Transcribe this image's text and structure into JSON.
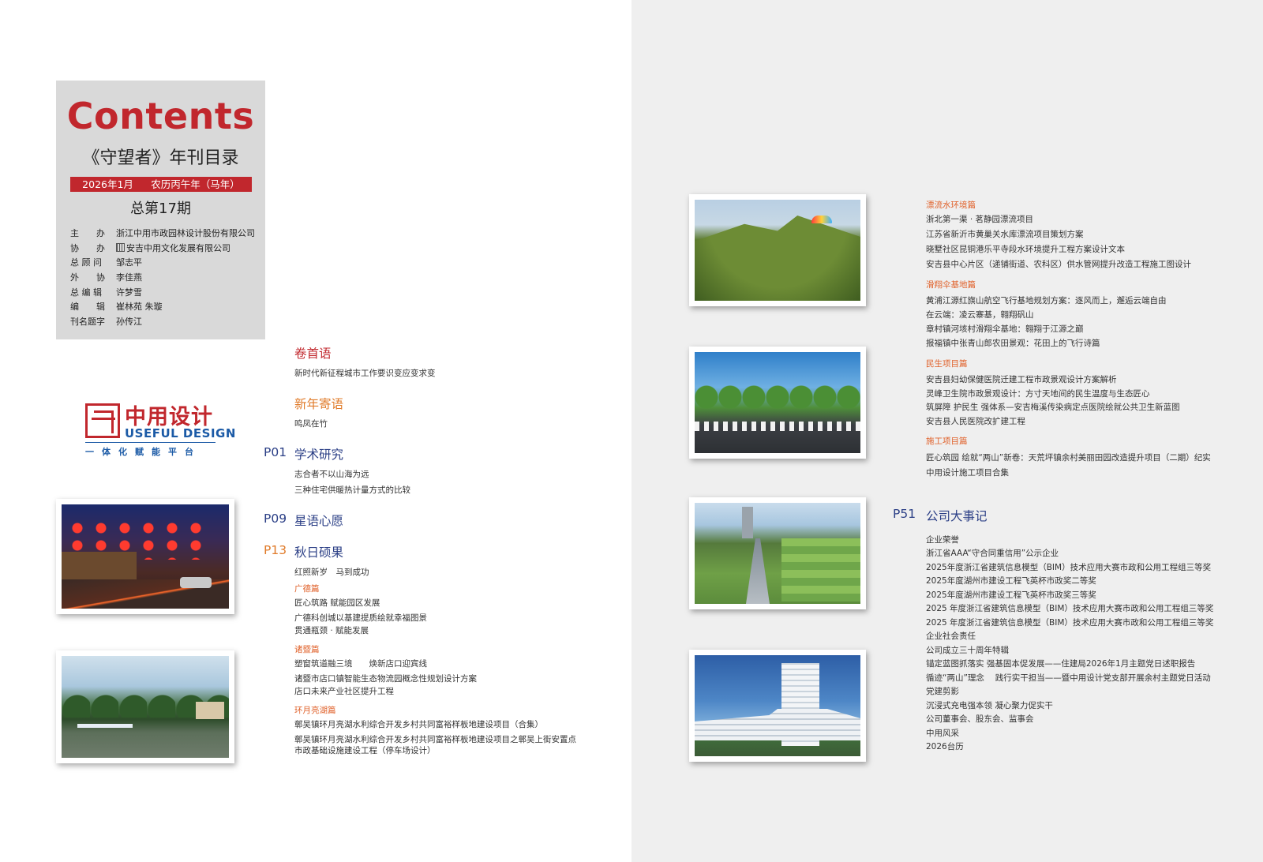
{
  "masthead": {
    "title": "Contents",
    "subtitle": "《守望者》年刊目录",
    "date": "2026年1月",
    "lunar": "农历丙午年（马年）",
    "issue": "总第17期",
    "credits": [
      {
        "role": "主　　办",
        "name": "浙江中用市政园林设计股份有限公司"
      },
      {
        "role": "协　　办",
        "name": "安吉中用文化发展有限公司"
      },
      {
        "role": "总 顾 问",
        "name": "邹志平"
      },
      {
        "role": "外　　协",
        "name": "李佳燕"
      },
      {
        "role": "总 编 辑",
        "name": "许梦雪"
      },
      {
        "role": "编　　辑",
        "name": "崔林苑 朱璇"
      },
      {
        "role": "刊名题字",
        "name": "孙传江"
      }
    ]
  },
  "logo": {
    "cn": "中用设计",
    "en": "USEFUL DESIGN",
    "tagline": "一体化赋能平台"
  },
  "left_toc": {
    "preface": {
      "title": "卷首语",
      "items": [
        "新时代新征程城市工作要识变应变求变"
      ]
    },
    "newyear": {
      "title": "新年寄语",
      "items": [
        "鸣凤在竹"
      ]
    },
    "academic": {
      "page": "P01",
      "title": "学术研究",
      "items": [
        "志合者不以山海为远",
        "三种住宅供暖热计量方式的比较"
      ]
    },
    "wishes": {
      "page": "P09",
      "title": "星语心愿"
    },
    "harvest": {
      "page": "P13",
      "title": "秋日硕果",
      "intro": "红照新岁　马到成功",
      "guangde": {
        "title": "广德篇",
        "items": [
          "匠心筑路 赋能园区发展",
          "广德科创城以基建提质绘就幸福图景",
          "贯通瓶颈 · 赋能发展"
        ]
      },
      "zhuji": {
        "title": "诸暨篇",
        "items": [
          "塑窗筑道融三境　　焕新店口迎宾线",
          "诸暨市店口镇智能生态物流园概念性规划设计方案",
          "店口未来产业社区提升工程"
        ]
      },
      "huanyue": {
        "title": "环月亮湖篇",
        "items": [
          "鄣吴镇环月亮湖水利综合开发乡村共同富裕样板地建设项目（合集）",
          "鄣吴镇环月亮湖水利综合开发乡村共同富裕样板地建设项目之鄣吴上街安置点",
          "市政基础设施建设工程（停车场设计）"
        ]
      }
    }
  },
  "right_toc": {
    "rafting": {
      "title": "漂流水环境篇",
      "items": [
        "浙北第一渠 · 茗静园漂流项目",
        "江苏省新沂市黄巢关水库漂流项目策划方案",
        "晓墅社区昆铜港乐平寺段水环境提升工程方案设计文本",
        "安吉县中心片区（递铺街道、农科区）供水管网提升改造工程施工图设计"
      ]
    },
    "paraglide": {
      "title": "滑翔伞基地篇",
      "items": [
        "黄浦江源红旗山航空飞行基地规划方案：逐风而上，邂逅云端自由",
        "在云端：凌云寨基，翱翔矾山",
        "章村镇河垓村滑翔伞基地：翱翔于江源之巅",
        "报福镇中张青山郎农田景观：花田上的飞行诗篇"
      ]
    },
    "livelihood": {
      "title": "民生项目篇",
      "items": [
        "安吉县妇幼保健医院迁建工程市政景观设计方案解析",
        "灵峰卫生院市政景观设计：方寸天地间的民生温度与生态匠心",
        "筑屏障 护民生 强体系—安吉梅溪传染病定点医院绘就公共卫生新蓝图",
        "安吉县人民医院改扩建工程"
      ]
    },
    "construction": {
      "title": "施工项目篇",
      "items": [
        "匠心筑园 绘就“两山”新卷：天荒坪镇余村美丽田园改造提升项目（二期）纪实",
        "中用设计施工项目合集"
      ]
    },
    "events": {
      "page": "P51",
      "title": "公司大事记",
      "items": [
        "企业荣誉",
        "浙江省AAA“守合同重信用”公示企业",
        "2025年度浙江省建筑信息模型（BIM）技术应用大赛市政和公用工程组三等奖",
        "2025年度湖州市建设工程飞英杯市政奖二等奖",
        "2025年度湖州市建设工程飞英杯市政奖三等奖",
        "2025 年度浙江省建筑信息模型（BIM）技术应用大赛市政和公用工程组三等奖",
        "2025 年度浙江省建筑信息模型（BIM）技术应用大赛市政和公用工程组三等奖",
        "企业社会责任",
        "公司成立三十周年特辑",
        "锚定蓝图抓落实 强基固本促发展——住建局2026年1月主题党日述职报告",
        "循迹“两山”理念　 践行实干担当——暨中用设计党支部开展余村主题党日活动",
        "党建剪影",
        "沉浸式充电强本领 凝心聚力促实干",
        "公司董事会、股东会、监事会",
        "中用风采",
        "2026台历"
      ]
    }
  },
  "colors": {
    "accent_red": "#c1272d",
    "accent_orange": "#e07b2a",
    "accent_blue": "#2b3f86",
    "logo_blue": "#1b5aa6"
  }
}
